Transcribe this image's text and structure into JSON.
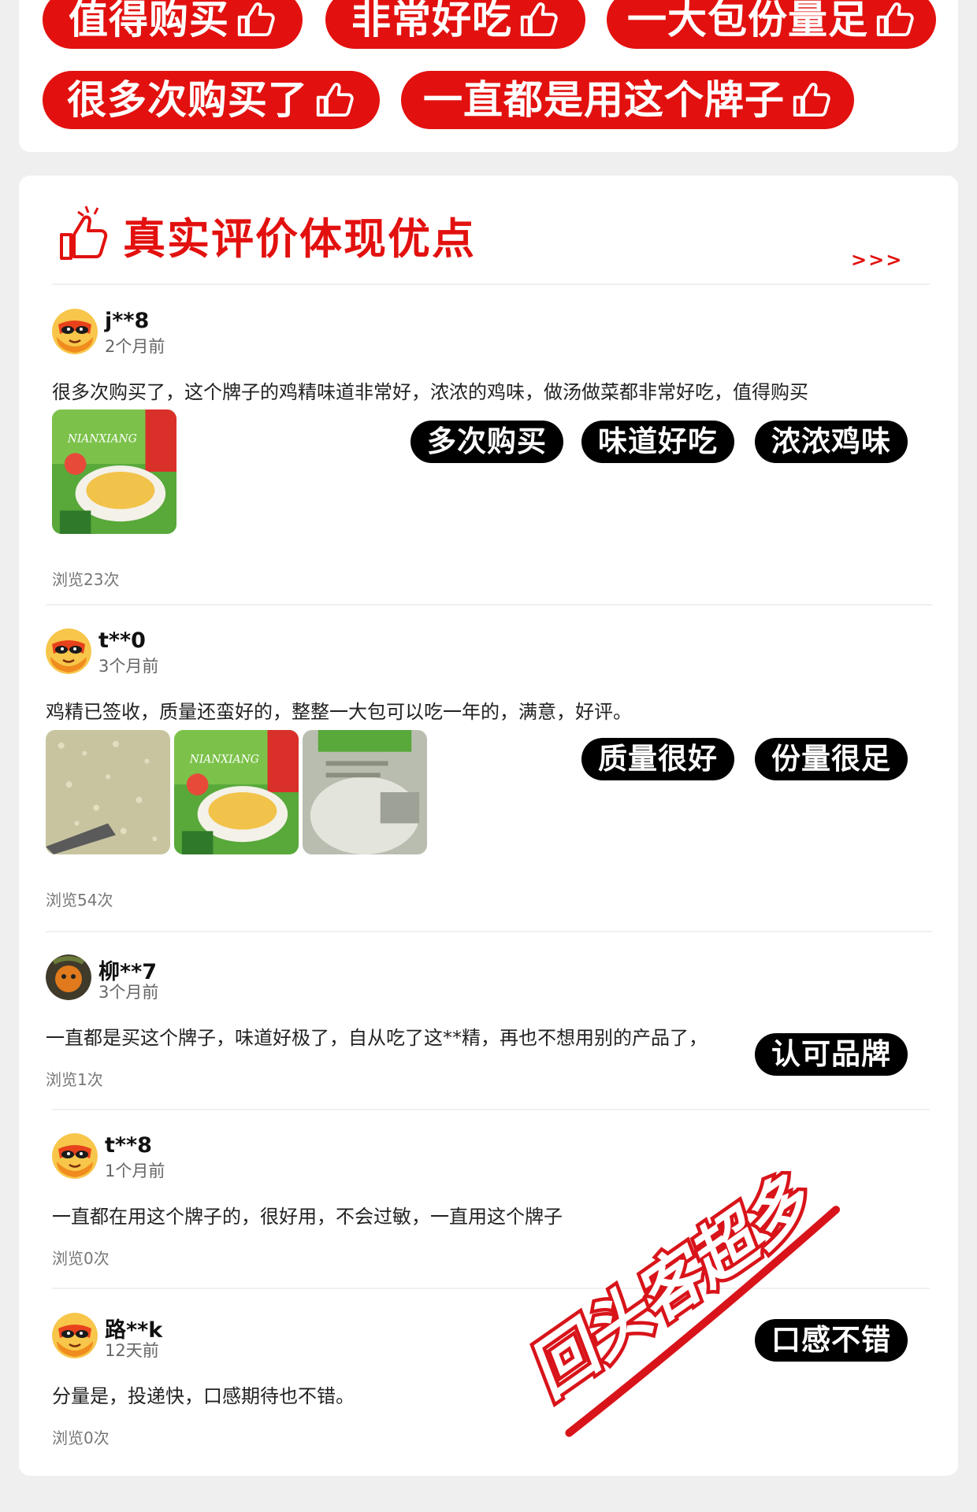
{
  "top_pills": [
    {
      "label": "值得购买"
    },
    {
      "label": "非常好吃"
    },
    {
      "label": "一大包份量足"
    },
    {
      "label": "很多次购买了"
    },
    {
      "label": "一直都是用这个牌子"
    }
  ],
  "section": {
    "title": "真实评价体现优点",
    "more": ">>>"
  },
  "reviews": [
    {
      "user": "j**8",
      "time": "2个月前",
      "text": "很多次购买了，这个牌子的鸡精味道非常好，浓浓的鸡味，做汤做菜都非常好吃，值得购买",
      "views": "浏览23次",
      "tags": [
        "多次购买",
        "味道好吃",
        "浓浓鸡味"
      ]
    },
    {
      "user": "t**0",
      "time": "3个月前",
      "text": "鸡精已签收，质量还蛮好的，整整一大包可以吃一年的，满意，好评。",
      "views": "浏览54次",
      "tags": [
        "质量很好",
        "份量很足"
      ]
    },
    {
      "user": "柳**7",
      "time": "3个月前",
      "text": "一直都是买这个牌子，味道好极了，自从吃了这**精，再也不想用别的产品了，",
      "views": "浏览1次",
      "tags": [
        "认可品牌"
      ]
    },
    {
      "user": "t**8",
      "time": "1个月前",
      "text": "一直都在用这个牌子的，很好用，不会过敏，一直用这个牌子",
      "views": "浏览0次",
      "tags": []
    },
    {
      "user": "路**k",
      "time": "12天前",
      "text": "分量是，投递快，口感期待也不错。",
      "views": "浏览0次",
      "tags": [
        "口感不错"
      ]
    }
  ],
  "stamp_text": "回头客超多",
  "colors": {
    "accent": "#e2110f",
    "tag_bg": "#000000"
  },
  "icons": {
    "pill": "thumbs-up-icon",
    "section": "thumbs-up-outline-icon"
  }
}
